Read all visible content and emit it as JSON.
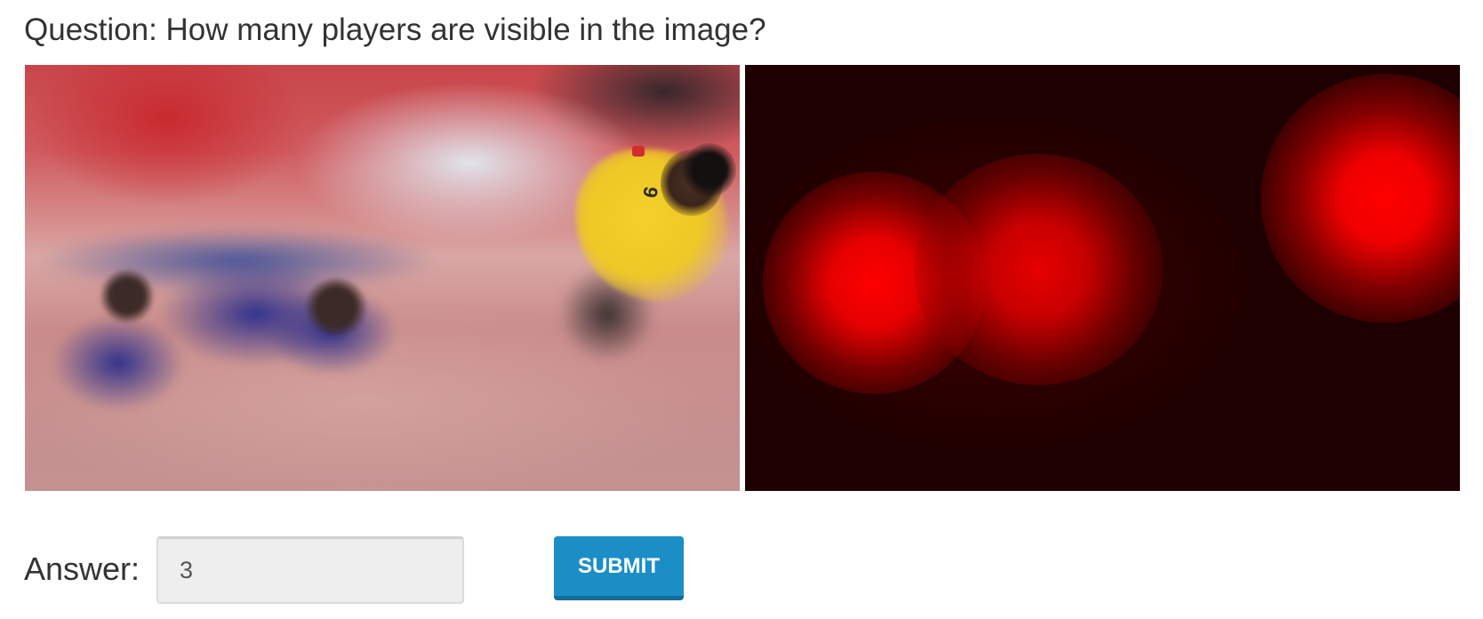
{
  "question": {
    "text": "Question: How many players are visible in the image?"
  },
  "images": {
    "photo_label": "",
    "jersey_number": "9",
    "heatmap_label": ""
  },
  "answer": {
    "label": "Answer:",
    "value": "3",
    "placeholder": ""
  },
  "submit": {
    "label": "SUBMIT"
  },
  "colors": {
    "submit_bg": "#1b8ec6",
    "heatmap_bg": "#1e0000",
    "heatmap_hot": "#ff0000",
    "text": "#333333"
  }
}
